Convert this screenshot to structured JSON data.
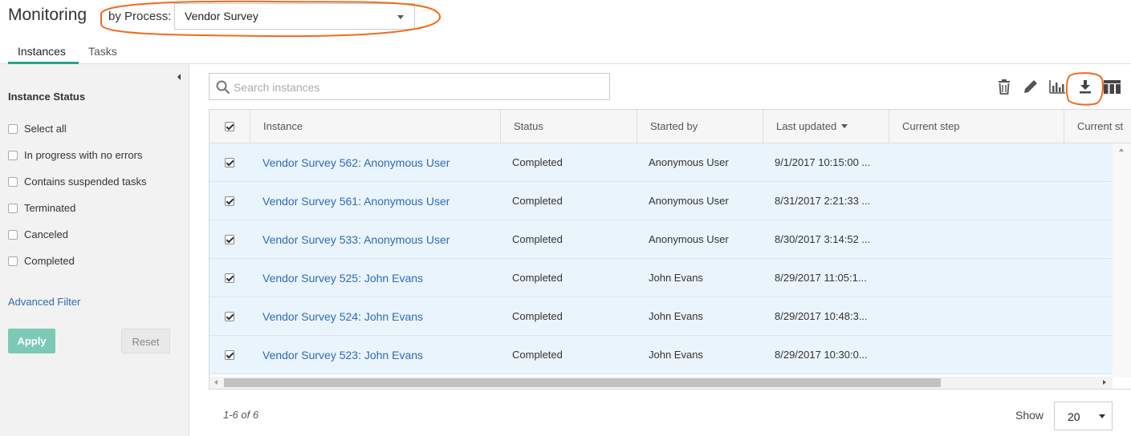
{
  "header": {
    "title": "Monitoring",
    "by_process_label": "by Process:",
    "process_selected": "Vendor Survey",
    "tabs": [
      {
        "label": "Instances",
        "active": true
      },
      {
        "label": "Tasks",
        "active": false
      }
    ],
    "accent_color": "#2aa18a",
    "annotation_color": "#f26a1b"
  },
  "sidebar": {
    "title": "Instance Status",
    "filters": [
      {
        "label": "Select all",
        "checked": false
      },
      {
        "label": "In progress with no errors",
        "checked": false
      },
      {
        "label": "Contains suspended tasks",
        "checked": false
      },
      {
        "label": "Terminated",
        "checked": false
      },
      {
        "label": "Canceled",
        "checked": false
      },
      {
        "label": "Completed",
        "checked": false
      }
    ],
    "advanced_filter_label": "Advanced Filter",
    "apply_label": "Apply",
    "reset_label": "Reset"
  },
  "search": {
    "placeholder": "Search instances",
    "value": ""
  },
  "toolbar": {
    "icons": [
      "trash-icon",
      "pencil-icon",
      "bar-chart-icon",
      "download-icon",
      "columns-icon"
    ]
  },
  "table": {
    "columns": [
      "Instance",
      "Status",
      "Started by",
      "Last updated",
      "Current step",
      "Current st"
    ],
    "sorted_column": "Last updated",
    "rows": [
      {
        "instance": "Vendor Survey 562: Anonymous User",
        "status": "Completed",
        "started_by": "Anonymous User",
        "last_updated": "9/1/2017 10:15:00 ...",
        "current_step": "",
        "checked": true
      },
      {
        "instance": "Vendor Survey 561: Anonymous User",
        "status": "Completed",
        "started_by": "Anonymous User",
        "last_updated": "8/31/2017 2:21:33 ...",
        "current_step": "",
        "checked": true
      },
      {
        "instance": "Vendor Survey 533: Anonymous User",
        "status": "Completed",
        "started_by": "Anonymous User",
        "last_updated": "8/30/2017 3:14:52 ...",
        "current_step": "",
        "checked": true
      },
      {
        "instance": "Vendor Survey 525: John Evans",
        "status": "Completed",
        "started_by": "John Evans",
        "last_updated": "8/29/2017 11:05:1...",
        "current_step": "",
        "checked": true
      },
      {
        "instance": "Vendor Survey 524: John Evans",
        "status": "Completed",
        "started_by": "John Evans",
        "last_updated": "8/29/2017 10:48:3...",
        "current_step": "",
        "checked": true
      },
      {
        "instance": "Vendor Survey 523: John Evans",
        "status": "Completed",
        "started_by": "John Evans",
        "last_updated": "8/29/2017 10:30:0...",
        "current_step": "",
        "checked": true
      }
    ],
    "row_highlight_color": "#eaf4fd",
    "link_color": "#2f6bb3"
  },
  "pager": {
    "range_text": "1-6 of 6",
    "show_label": "Show",
    "page_size": "20"
  }
}
